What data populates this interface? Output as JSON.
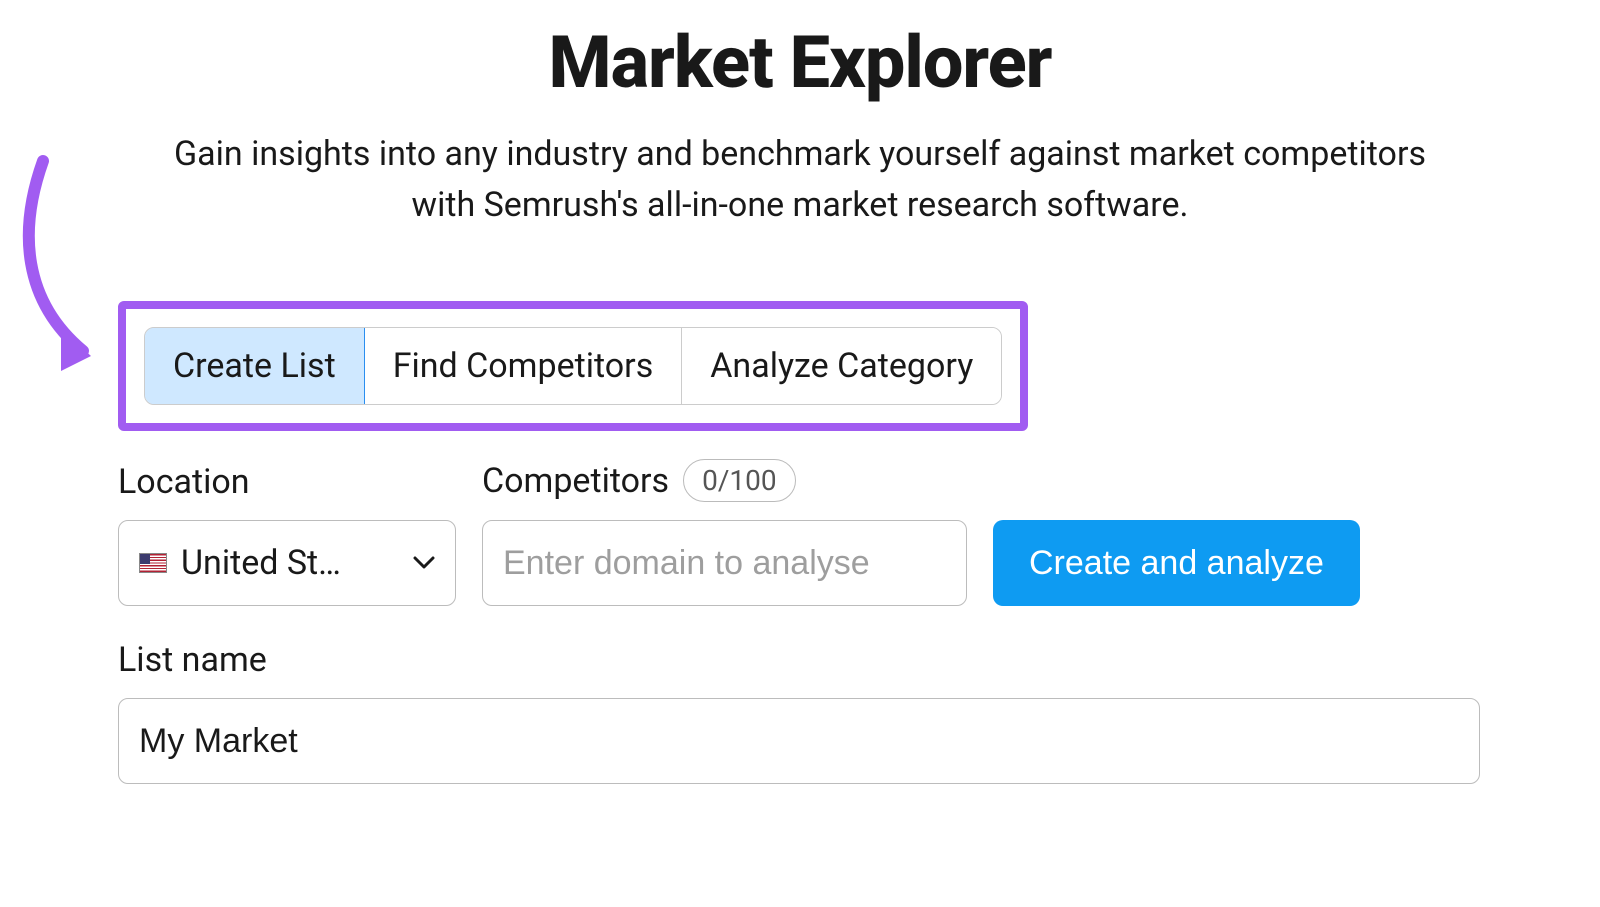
{
  "header": {
    "title": "Market Explorer",
    "subtitle": "Gain insights into any industry and benchmark yourself against market competitors with Semrush's all-in-one market research software."
  },
  "tabs": {
    "create_list": "Create List",
    "find_competitors": "Find Competitors",
    "analyze_category": "Analyze Category"
  },
  "form": {
    "location_label": "Location",
    "location_value": "United St…",
    "competitors_label": "Competitors",
    "competitors_badge": "0/100",
    "competitors_placeholder": "Enter domain to analyse",
    "submit_label": "Create and analyze",
    "listname_label": "List name",
    "listname_value": "My Market"
  },
  "colors": {
    "accent_purple": "#a15cf1",
    "primary_blue": "#0e9bf2",
    "tab_active_bg": "#cfe8ff"
  }
}
